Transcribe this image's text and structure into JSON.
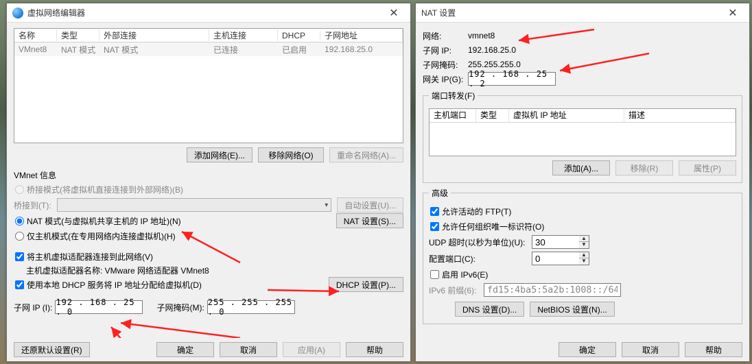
{
  "left": {
    "title": "虚拟网络编辑器",
    "table": {
      "headers": {
        "name": "名称",
        "type": "类型",
        "external": "外部连接",
        "host": "主机连接",
        "dhcp": "DHCP",
        "subnet": "子网地址"
      },
      "row": {
        "name": "VMnet8",
        "type": "NAT 模式",
        "external": "NAT 模式",
        "host": "已连接",
        "dhcp": "已启用",
        "subnet": "192.168.25.0"
      }
    },
    "buttons": {
      "add_net": "添加网络(E)...",
      "remove_net": "移除网络(O)",
      "rename_net": "重命名网络(A)..."
    },
    "vmnet_info_title": "VMnet 信息",
    "radio_bridged": "桥接模式(将虚拟机直接连接到外部网络)(B)",
    "bridged_to_label": "桥接到(T):",
    "auto_config": "自动设置(U)...",
    "radio_nat": "NAT 模式(与虚拟机共享主机的 IP 地址)(N)",
    "nat_settings": "NAT 设置(S)...",
    "radio_hostonly": "仅主机模式(在专用网络内连接虚拟机)(H)",
    "chk_connect_host": "将主机虚拟适配器连接到此网络(V)",
    "adapter_name_label": "主机虚拟适配器名称: VMware 网络适配器 VMnet8",
    "chk_dhcp": "使用本地 DHCP 服务将 IP 地址分配给虚拟机(D)",
    "dhcp_settings": "DHCP 设置(P)...",
    "subnet_ip_label": "子网 IP (I):",
    "subnet_ip": "192 . 168 .  25  .  0",
    "subnet_mask_label": "子网掩码(M):",
    "subnet_mask": "255 . 255 . 255 .  0",
    "restore_defaults": "还原默认设置(R)",
    "ok": "确定",
    "cancel": "取消",
    "apply": "应用(A)",
    "help": "帮助"
  },
  "right": {
    "title": "NAT 设置",
    "kv": {
      "net_label": "网络:",
      "net": "vmnet8",
      "subnetip_label": "子网 IP:",
      "subnetip": "192.168.25.0",
      "mask_label": "子网掩码:",
      "mask": "255.255.255.0"
    },
    "gateway_label": "网关 IP(G):",
    "gateway_ip": "192 . 168 .  25  .  2",
    "port_fw_title": "端口转发(F)",
    "pf_headers": {
      "hostport": "主机端口",
      "type": "类型",
      "vmip": "虚拟机 IP 地址",
      "desc": "描述"
    },
    "btn_add": "添加(A)...",
    "btn_remove": "移除(R)",
    "btn_props": "属性(P)",
    "adv_title": "高级",
    "chk_ftp": "允许活动的 FTP(T)",
    "chk_oui": "允许任何组织唯一标识符(O)",
    "udp_label": "UDP 超时(以秒为单位)(U):",
    "udp_val": "30",
    "cfg_port_label": "配置端口(C):",
    "cfg_port_val": "0",
    "chk_ipv6": "启用 IPv6(E)",
    "ipv6_prefix_label": "IPv6 前缀(6):",
    "ipv6_prefix": "fd15:4ba5:5a2b:1008::/64",
    "btn_dns": "DNS 设置(D)...",
    "btn_netbios": "NetBIOS 设置(N)...",
    "ok": "确定",
    "cancel": "取消",
    "help": "帮助"
  }
}
